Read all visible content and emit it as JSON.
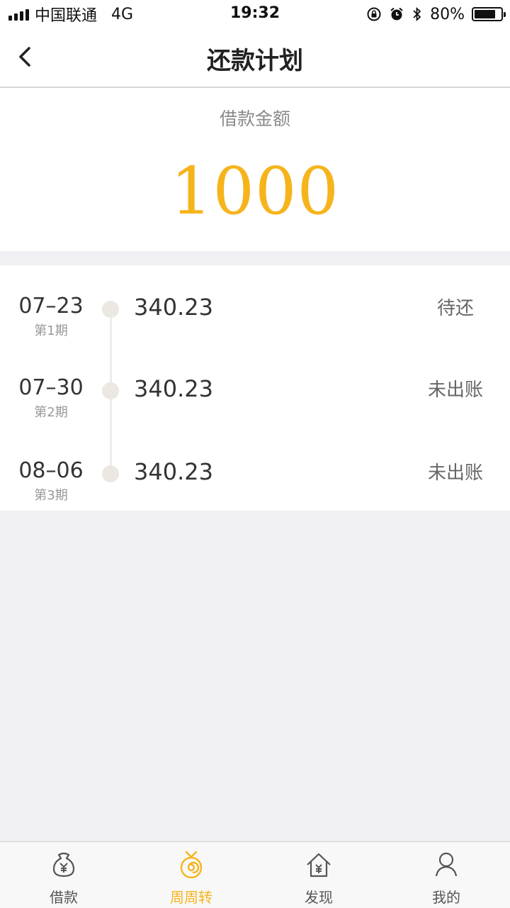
{
  "status": {
    "carrier": "中国联通",
    "network": "4G",
    "time": "19:32",
    "battery": "80%",
    "battery_level": 0.8
  },
  "nav": {
    "title": "还款计划"
  },
  "loan": {
    "label": "借款金额",
    "amount": "1000"
  },
  "plan": [
    {
      "date": "07–23",
      "period": "第1期",
      "amount": "340.23",
      "status": "待还"
    },
    {
      "date": "07–30",
      "period": "第2期",
      "amount": "340.23",
      "status": "未出账"
    },
    {
      "date": "08–06",
      "period": "第3期",
      "amount": "340.23",
      "status": "未出账"
    }
  ],
  "tabs": [
    {
      "label": "借款",
      "icon": "money-bag-icon"
    },
    {
      "label": "周周转",
      "icon": "spiral-coin-icon",
      "active": true
    },
    {
      "label": "发现",
      "icon": "house-yen-icon"
    },
    {
      "label": "我的",
      "icon": "person-icon"
    }
  ],
  "colors": {
    "accent": "#f6b41c",
    "background": "#efeff4"
  }
}
